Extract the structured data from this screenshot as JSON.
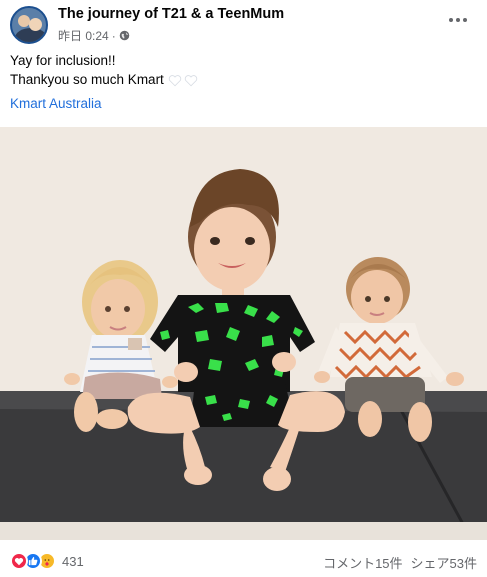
{
  "post": {
    "page_name": "The journey of T21 & a TeenMum",
    "timestamp": "昨日 0:24",
    "separator": "·",
    "privacy_icon": "globe-icon",
    "text_line_1": "Yay for inclusion!!",
    "text_line_2": "Thankyou so much Kmart",
    "emoji": "white-heart-icon",
    "mention": "Kmart Australia"
  },
  "photo": {
    "subject": "toddler in green dinosaur shirt sitting between two dolls"
  },
  "footer": {
    "reaction_icons": [
      "love-reaction-icon",
      "like-reaction-icon",
      "care-reaction-icon"
    ],
    "reaction_count": "431",
    "comments": "コメント15件",
    "shares": "シェア53件"
  },
  "colors": {
    "link": "#216fdb",
    "secondary_text": "#65676b",
    "love": "#f0284a",
    "like": "#1877f2",
    "care": "#f7b928"
  }
}
